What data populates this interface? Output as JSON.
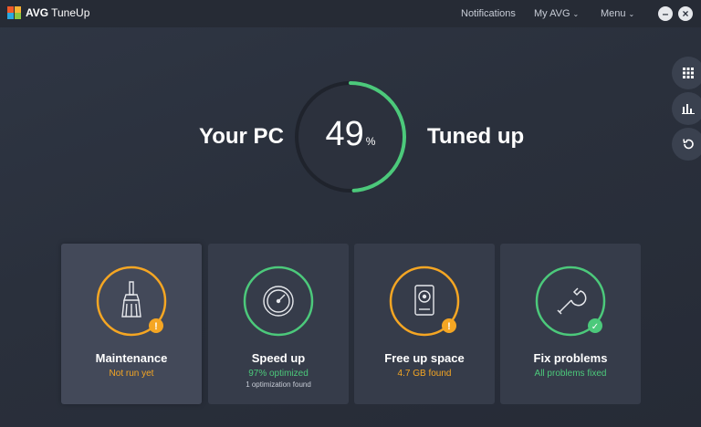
{
  "app": {
    "brand": "AVG",
    "product": "TuneUp"
  },
  "nav": {
    "notifications": "Notifications",
    "my_avg": "My AVG",
    "menu": "Menu"
  },
  "window": {
    "minimize": "–",
    "close": "×"
  },
  "hero": {
    "left_label": "Your PC",
    "value": "49",
    "unit": "%",
    "progress": 0.49,
    "right_label": "Tuned up"
  },
  "side_tools": [
    "apps-grid-icon",
    "bar-chart-icon",
    "undo-icon"
  ],
  "cards": [
    {
      "title": "Maintenance",
      "status": "Not run yet",
      "status_color": "#f5a623",
      "badge": "!",
      "icon": "broom-icon"
    },
    {
      "title": "Speed up",
      "status": "97% optimized",
      "sub": "1 optimization found",
      "status_color": "#4cc97b",
      "icon": "speedometer-icon"
    },
    {
      "title": "Free up space",
      "status": "4.7 GB found",
      "status_color": "#f5a623",
      "badge": "!",
      "icon": "hard-drive-icon"
    },
    {
      "title": "Fix problems",
      "status": "All problems fixed",
      "status_color": "#4cc97b",
      "badge": "✓",
      "icon": "wrench-icon"
    }
  ],
  "colors": {
    "orange": "#f5a623",
    "green": "#4cc97b",
    "background": "#2b313d"
  }
}
